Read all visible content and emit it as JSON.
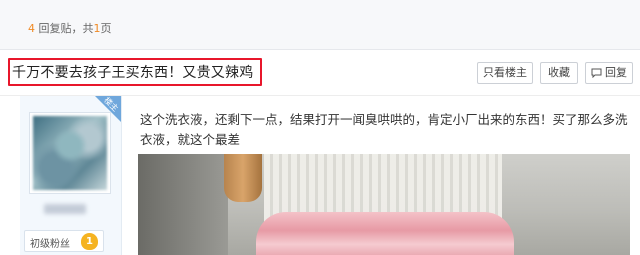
{
  "reply_bar": {
    "reply_count": "4",
    "reply_suffix": " 回复贴，共",
    "page_count": "1",
    "page_suffix": "页"
  },
  "post": {
    "title": "千万不要去孩子王买东西！又贵又辣鸡",
    "body": "这个洗衣液，还剩下一点，结果打开一闻臭哄哄的，肯定小厂出来的东西！买了那么多洗衣液，就这个最差"
  },
  "actions": {
    "only_author": "只看楼主",
    "collect": "收藏",
    "reply": "回复"
  },
  "author": {
    "corner_tag": "楼主",
    "rank_label": "初级粉丝",
    "rank_level": "1"
  },
  "colors": {
    "highlight_border": "#e8162b",
    "accent_orange": "#f08a24",
    "corner_blue": "#6fa7dc",
    "rank_gold": "#f5b322"
  }
}
